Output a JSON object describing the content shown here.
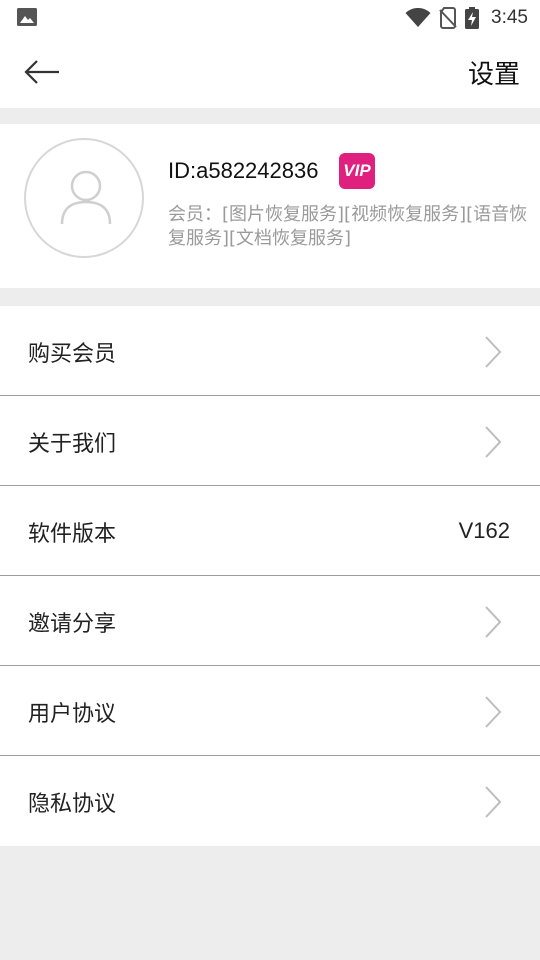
{
  "status_bar": {
    "time": "3:45",
    "icons": [
      "image-icon",
      "wifi-icon",
      "no-sim-icon",
      "battery-charging-icon"
    ]
  },
  "header": {
    "title": "设置",
    "back_icon": "arrow-left-icon"
  },
  "profile": {
    "user_id": "ID:a582242836",
    "vip_badge": "VIP",
    "membership": "会员：[图片恢复服务][视频恢复服务][语音恢复服务][文档恢复服务]"
  },
  "menu": {
    "items": [
      {
        "label": "购买会员"
      },
      {
        "label": "关于我们"
      },
      {
        "label": "软件版本",
        "value": "V162"
      },
      {
        "label": "邀请分享"
      },
      {
        "label": "用户协议"
      },
      {
        "label": "隐私协议"
      }
    ]
  },
  "colors": {
    "accent": "#e0207e",
    "background": "#ededed",
    "divider": "#9e9e9e",
    "secondary_text": "#9a9a9a"
  }
}
